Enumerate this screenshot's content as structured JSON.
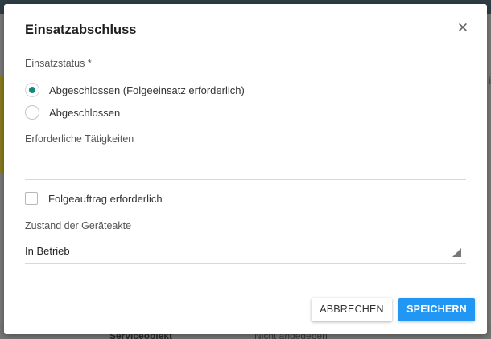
{
  "background": {
    "right_text": "i",
    "bottom_label": "Serviceobjekt",
    "bottom_value": "Nicht angegeben"
  },
  "dialog": {
    "title": "Einsatzabschluss",
    "close_icon": "close-icon",
    "status": {
      "label": "Einsatzstatus *",
      "options": [
        {
          "label": "Abgeschlossen (Folgeeinsatz erforderlich)",
          "checked": true
        },
        {
          "label": "Abgeschlossen",
          "checked": false
        }
      ]
    },
    "activities": {
      "label": "Erforderliche Tätigkeiten",
      "value": ""
    },
    "follow_up": {
      "label": "Folgeauftrag erforderlich",
      "checked": false
    },
    "device_state": {
      "label": "Zustand der Geräteakte",
      "selected": "In Betrieb"
    },
    "buttons": {
      "cancel": "ABBRECHEN",
      "save": "SPEICHERN"
    }
  },
  "colors": {
    "accent": "#0f8a7a",
    "primary_button": "#2196f3"
  }
}
